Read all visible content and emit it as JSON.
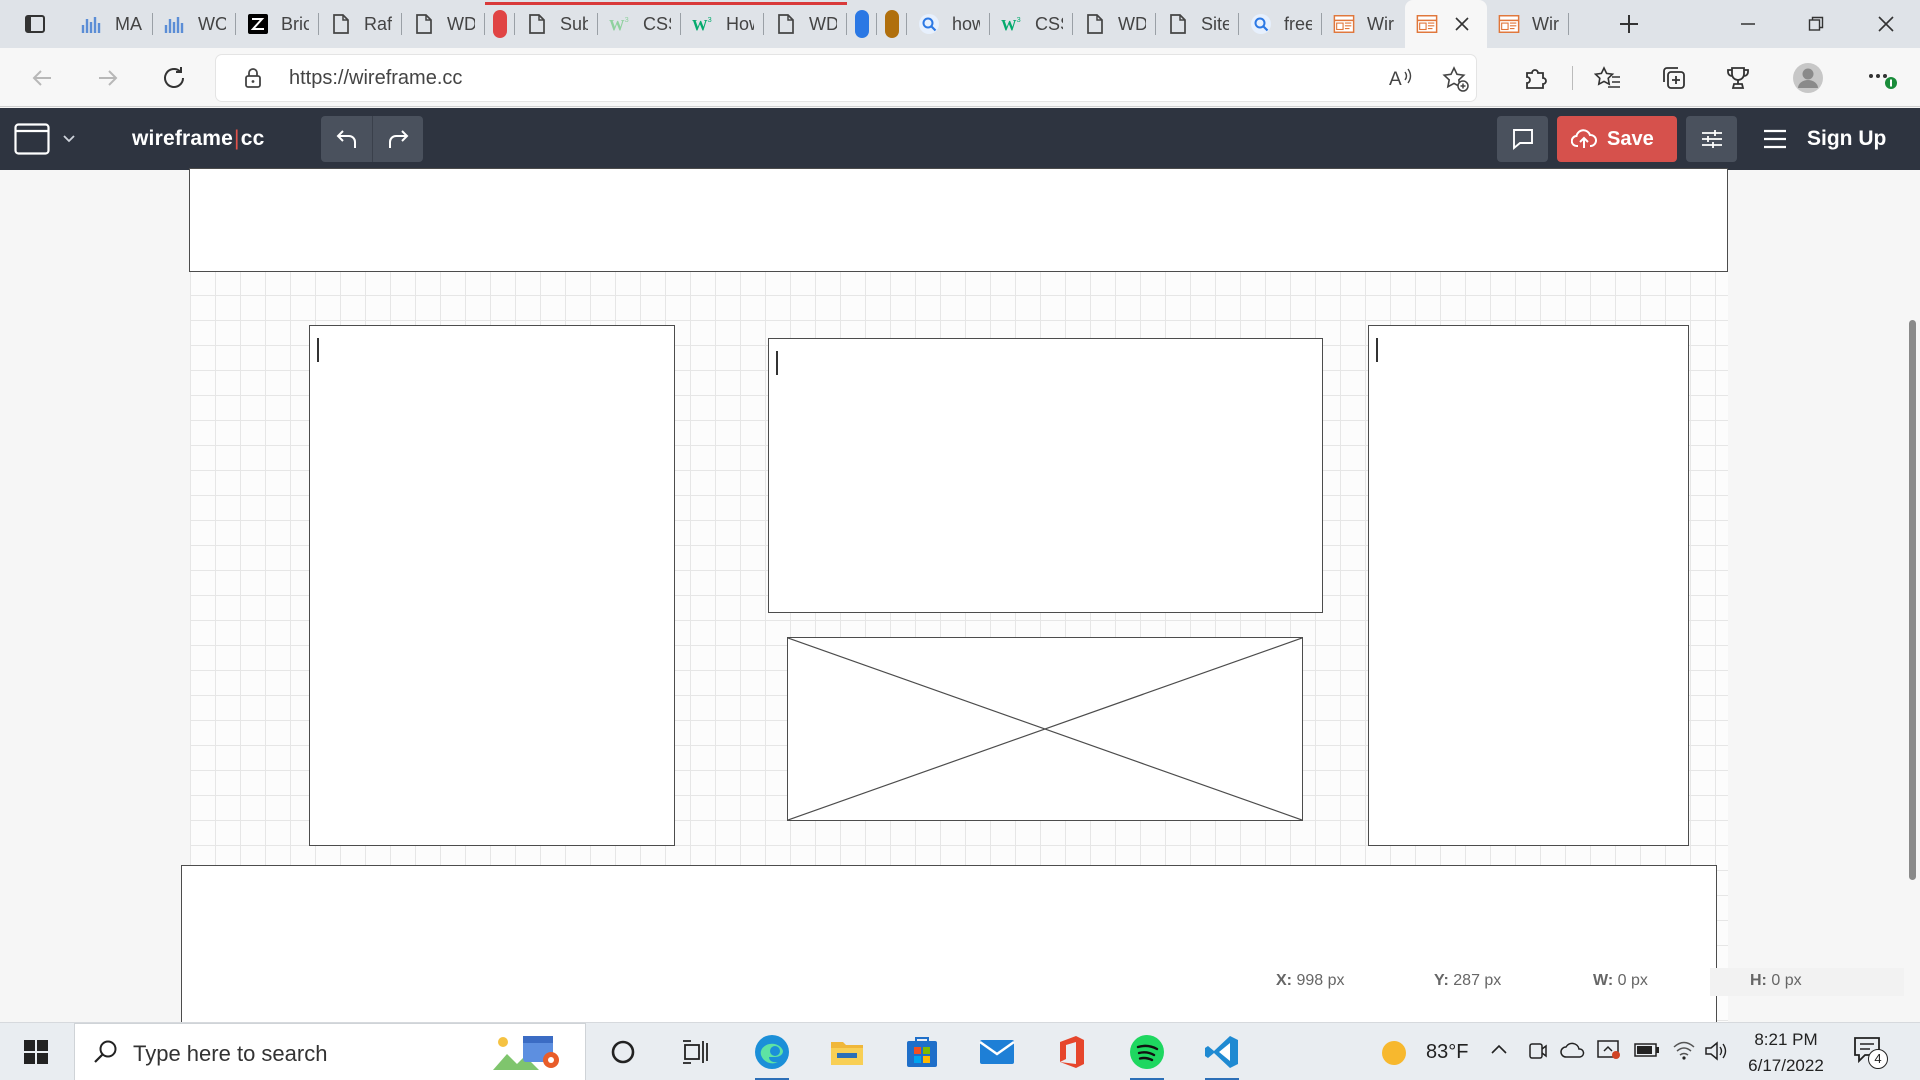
{
  "browser": {
    "tabs": [
      {
        "title": "MA",
        "icon": "chart-icon",
        "color": "#5b8dd6"
      },
      {
        "title": "WO",
        "icon": "chart-icon",
        "color": "#5b8dd6"
      },
      {
        "title": "Bric",
        "icon": "bricks-icon",
        "color": "#000000"
      },
      {
        "title": "Raft",
        "icon": "page-icon",
        "color": "#444444"
      },
      {
        "title": "WD",
        "icon": "page-icon",
        "color": "#444444"
      },
      {
        "title": "",
        "icon": "pill-icon",
        "color": "#e04444"
      },
      {
        "title": "Sub",
        "icon": "page-icon",
        "color": "#444444"
      },
      {
        "title": "CSS",
        "icon": "w3-icon",
        "color": "#8fd19e"
      },
      {
        "title": "How",
        "icon": "w3-icon",
        "color": "#04aa6d"
      },
      {
        "title": "WD",
        "icon": "page-icon",
        "color": "#444444"
      },
      {
        "title": "",
        "icon": "pill-icon",
        "color": "#2b78e4"
      },
      {
        "title": "",
        "icon": "pill-icon",
        "color": "#b06f0d"
      },
      {
        "title": "how",
        "icon": "search-icon",
        "color": "#2b78e4"
      },
      {
        "title": "CSS",
        "icon": "w3-icon",
        "color": "#04aa6d"
      },
      {
        "title": "WD",
        "icon": "page-icon",
        "color": "#444444"
      },
      {
        "title": "Site",
        "icon": "page-icon",
        "color": "#444444"
      },
      {
        "title": "free",
        "icon": "search-icon",
        "color": "#2b78e4"
      },
      {
        "title": "Wir",
        "icon": "wireframe-icon",
        "color": "#e0763a"
      },
      {
        "title": "",
        "icon": "wireframe-icon",
        "color": "#e0763a"
      },
      {
        "title": "Wir",
        "icon": "wireframe-icon",
        "color": "#e0763a"
      }
    ],
    "url": "https://wireframe.cc"
  },
  "app": {
    "brand_left": "wireframe",
    "brand_pipe": "|",
    "brand_right": "cc",
    "save_label": "Save",
    "signup_label": "Sign Up",
    "accent": "#d6514c",
    "header_bg": "#2e3440"
  },
  "status": {
    "x_label": "X:",
    "x_value": "998 px",
    "y_label": "Y:",
    "y_value": "287 px",
    "w_label": "W:",
    "w_value": "0 px",
    "h_label": "H:",
    "h_value": "0 px"
  },
  "taskbar": {
    "search_placeholder": "Type here to search",
    "temperature": "83°F",
    "time": "8:21 PM",
    "date": "6/17/2022",
    "notification_count": "4"
  }
}
